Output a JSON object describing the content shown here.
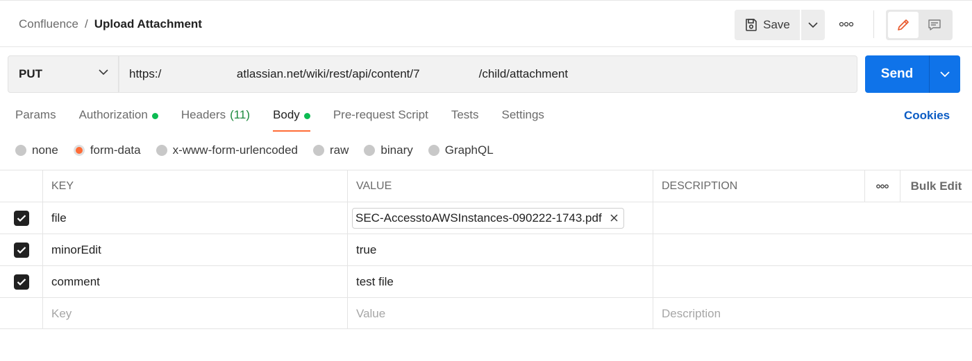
{
  "breadcrumb": {
    "parent": "Confluence",
    "separator": "/",
    "current": "Upload Attachment"
  },
  "header": {
    "save_label": "Save"
  },
  "request": {
    "method": "PUT",
    "url": "https:/                       atlassian.net/wiki/rest/api/content/7                  /child/attachment",
    "send_label": "Send"
  },
  "tabs": [
    {
      "label": "Params"
    },
    {
      "label": "Authorization"
    },
    {
      "label": "Headers",
      "count": "(11)"
    },
    {
      "label": "Body"
    },
    {
      "label": "Pre-request Script"
    },
    {
      "label": "Tests"
    },
    {
      "label": "Settings"
    }
  ],
  "cookies_label": "Cookies",
  "body_types": [
    "none",
    "form-data",
    "x-www-form-urlencoded",
    "raw",
    "binary",
    "GraphQL"
  ],
  "table": {
    "headers": {
      "key": "KEY",
      "value": "VALUE",
      "description": "DESCRIPTION",
      "bulk_edit": "Bulk Edit"
    },
    "rows": [
      {
        "key": "file",
        "value": "SEC-AccesstoAWSInstances-090222-1743.pdf"
      },
      {
        "key": "minorEdit",
        "value": "true"
      },
      {
        "key": "comment",
        "value": "test file"
      }
    ],
    "placeholders": {
      "key": "Key",
      "value": "Value",
      "description": "Description"
    }
  },
  "colors": {
    "accent": "#ff6c37",
    "primary": "#0f73e9",
    "status_green": "#0cbb52",
    "link": "#0b5cc4"
  }
}
